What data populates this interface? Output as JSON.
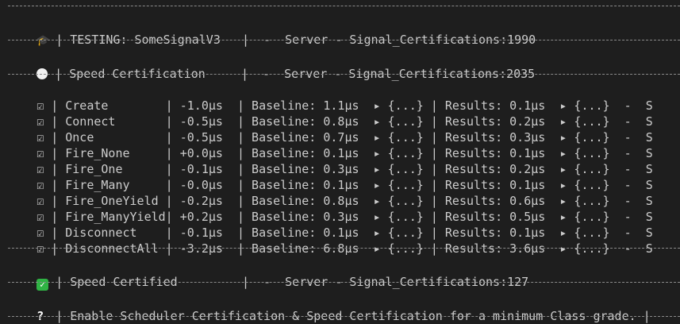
{
  "header": {
    "icon": "graduation-cap-icon",
    "testing": "| TESTING: SomeSignalV3   |  -  Server - Signal_Certifications:1990"
  },
  "speed_cert": {
    "icon": "white-circle-icon",
    "text": "| Speed Certification     |  -  Server - Signal_Certifications:2035"
  },
  "rows": [
    {
      "check": "☑",
      "text": "| Create        | -1.0µs  | Baseline: 1.1µs  ▸ {...} | Results: 0.1µs  ▸ {...}  -  S"
    },
    {
      "check": "☑",
      "text": "| Connect       | -0.5µs  | Baseline: 0.8µs  ▸ {...} | Results: 0.2µs  ▸ {...}  -  S"
    },
    {
      "check": "☑",
      "text": "| Once          | -0.5µs  | Baseline: 0.7µs  ▸ {...} | Results: 0.3µs  ▸ {...}  -  S"
    },
    {
      "check": "☑",
      "text": "| Fire_None     | +0.0µs  | Baseline: 0.1µs  ▸ {...} | Results: 0.1µs  ▸ {...}  -  S"
    },
    {
      "check": "☑",
      "text": "| Fire_One      | -0.1µs  | Baseline: 0.3µs  ▸ {...} | Results: 0.2µs  ▸ {...}  -  S"
    },
    {
      "check": "☑",
      "text": "| Fire_Many     | -0.0µs  | Baseline: 0.1µs  ▸ {...} | Results: 0.1µs  ▸ {...}  -  S"
    },
    {
      "check": "☑",
      "text": "| Fire_OneYield | -0.2µs  | Baseline: 0.8µs  ▸ {...} | Results: 0.6µs  ▸ {...}  -  S"
    },
    {
      "check": "☑",
      "text": "| Fire_ManyYield| +0.2µs  | Baseline: 0.3µs  ▸ {...} | Results: 0.5µs  ▸ {...}  -  S"
    },
    {
      "check": "☑",
      "text": "| Disconnect    | -0.1µs  | Baseline: 0.1µs  ▸ {...} | Results: 0.1µs  ▸ {...}  -  S"
    },
    {
      "check": "☑",
      "text": "| DisconnectAll | -3.2µs  | Baseline: 6.8µs  ▸ {...} | Results: 3.6µs  ▸ {...}  -  S"
    }
  ],
  "certified": {
    "icon": "green-check-icon",
    "mark": "✓",
    "text": "| Speed Certified         |  -  Server - Signal_Certifications:127"
  },
  "hint": {
    "icon": "question-mark-icon",
    "mark": "?",
    "text": "| Enable Scheduler Certification & Speed Certification for a minimum Class grade. |"
  },
  "colors": {
    "background": "#1e1e1e",
    "text": "#cccccc",
    "separator": "#8a8a8a",
    "check_green": "#2fb344"
  }
}
